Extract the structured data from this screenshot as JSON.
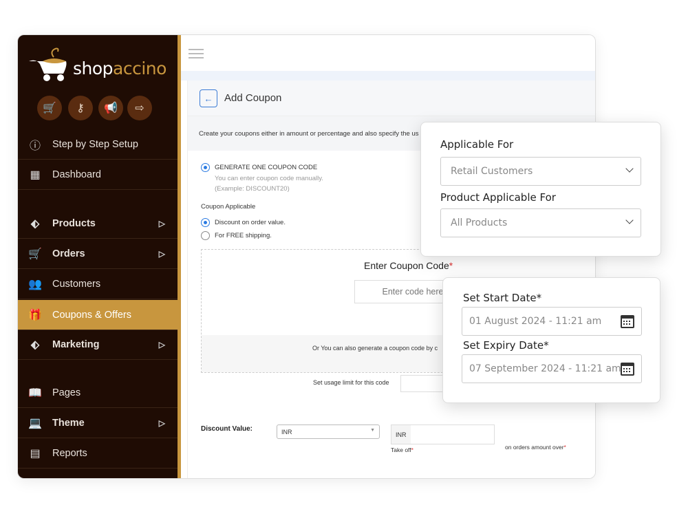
{
  "brand": {
    "part1": "shop",
    "part2": "accino"
  },
  "quick_actions": [
    {
      "icon": "cart-icon",
      "glyph": "🛒"
    },
    {
      "icon": "key-icon",
      "glyph": "⚷"
    },
    {
      "icon": "megaphone-icon",
      "glyph": "📢"
    },
    {
      "icon": "logout-icon",
      "glyph": "⇨"
    }
  ],
  "sidebar": {
    "items": [
      {
        "label": "Step by Step Setup",
        "icon": "info-icon",
        "glyph": "ⓘ"
      },
      {
        "label": "Dashboard",
        "icon": "grid-icon",
        "glyph": "▦"
      },
      {
        "label": "Products",
        "icon": "tag-icon",
        "glyph": "⬖"
      },
      {
        "label": "Orders",
        "icon": "cart-icon",
        "glyph": "🛒"
      },
      {
        "label": "Customers",
        "icon": "users-icon",
        "glyph": "👥"
      },
      {
        "label": "Coupons & Offers",
        "icon": "gift-icon",
        "glyph": "🎁"
      },
      {
        "label": "Marketing",
        "icon": "tag-icon",
        "glyph": "⬖"
      },
      {
        "label": "Pages",
        "icon": "book-icon",
        "glyph": "📖"
      },
      {
        "label": "Theme",
        "icon": "laptop-icon",
        "glyph": "💻"
      },
      {
        "label": "Reports",
        "icon": "report-icon",
        "glyph": "▤"
      }
    ],
    "active": "Coupons & Offers",
    "accent": "#c8963e"
  },
  "page": {
    "title": "Add Coupon",
    "description": "Create your coupons either in amount or percentage and also specify the us"
  },
  "form": {
    "generate_label": "GENERATE ONE COUPON CODE",
    "generate_hint1": "You can enter coupon code manually.",
    "generate_hint2": "(Example: DISCOUNT20)",
    "applicable_title": "Coupon Applicable",
    "opt_discount": "Discount on order value.",
    "opt_shipping": "For FREE shipping.",
    "enter_code_title": "Enter Coupon Code",
    "required_mark": "*",
    "code_placeholder": "Enter code here",
    "generate_note": "Or You can also generate a coupon code by c",
    "usage_label": "Set usage limit for this code",
    "discount_label": "Discount Value:",
    "currency_select": "INR",
    "currency_prefix": "INR",
    "take_off": "Take off",
    "orders_over": "on orders amount over"
  },
  "applicable_card": {
    "applicable_for_label": "Applicable For",
    "applicable_for_value": "Retail Customers",
    "product_label": "Product Applicable For",
    "product_value": "All Products"
  },
  "date_card": {
    "start_label": "Set Start Date*",
    "start_value": "01 August 2024 - 11:21 am",
    "expiry_label": "Set Expiry Date*",
    "expiry_value": "07 September 2024 - 11:21 am"
  }
}
